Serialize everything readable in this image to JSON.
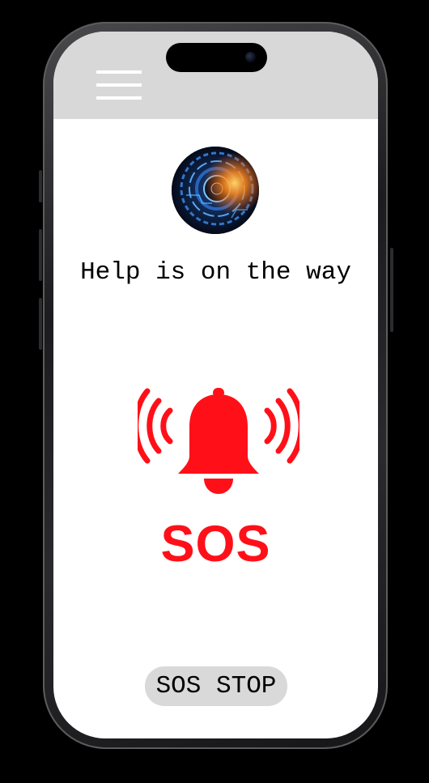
{
  "screen": {
    "status_text": "Help is on the way",
    "sos_label": "SOS",
    "stop_button_label": "SOS STOP"
  },
  "header": {
    "menu_icon": "hamburger-menu-icon"
  },
  "avatar": {
    "icon": "camera-lens-avatar"
  },
  "alert": {
    "icon": "ringing-bell-icon"
  },
  "colors": {
    "alert_red": "#ff1019",
    "header_gray": "#d8d8d8",
    "button_gray": "#d9d9d9",
    "screen_bg": "#ffffff"
  }
}
